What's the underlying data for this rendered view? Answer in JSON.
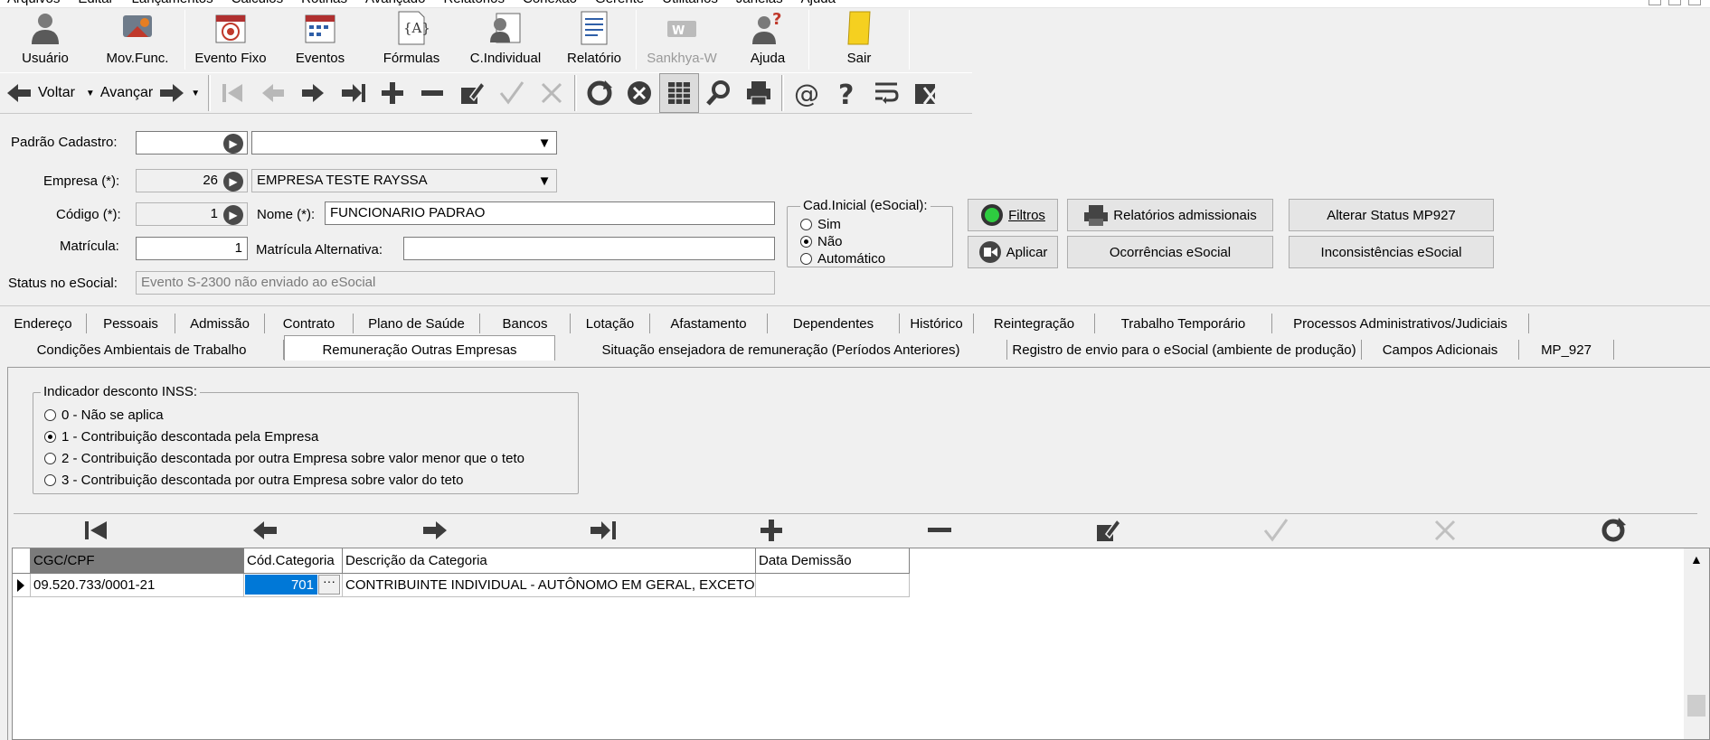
{
  "menu": [
    "Arquivos",
    "Editar",
    "Lançamentos",
    "Cálculos",
    "Rotinas",
    "Avançado",
    "Relatórios",
    "Conexão",
    "Gerente",
    "Utilitários",
    "Janelas",
    "Ajuda"
  ],
  "toolbar_main": {
    "usuario": "Usuário",
    "mov_func": "Mov.Func.",
    "evento_fixo": "Evento Fixo",
    "eventos": "Eventos",
    "formulas": "Fórmulas",
    "c_individual": "C.Individual",
    "relatorio": "Relatório",
    "sankhya": "Sankhya-W",
    "ajuda": "Ajuda",
    "sair": "Sair"
  },
  "toolbar_nav": {
    "voltar": "Voltar",
    "avancar": "Avançar"
  },
  "form": {
    "padrao_cadastro_label": "Padrão Cadastro:",
    "padrao_cadastro_code": "",
    "padrao_cadastro_name": "",
    "empresa_label": "Empresa (*):",
    "empresa_code": "26",
    "empresa_name": "EMPRESA TESTE RAYSSA",
    "codigo_label": "Código (*):",
    "codigo_value": "1",
    "nome_label": "Nome (*):",
    "nome_value": "FUNCIONARIO PADRAO",
    "matricula_label": "Matrícula:",
    "matricula_value": "1",
    "matricula_alt_label": "Matrícula Alternativa:",
    "matricula_alt_value": "",
    "status_label": "Status no eSocial:",
    "status_value": "Evento S-2300 não enviado ao eSocial"
  },
  "cad_inicial": {
    "title": "Cad.Inicial (eSocial):",
    "options": [
      "Sim",
      "Não",
      "Automático"
    ],
    "selected": "Não"
  },
  "buttons": {
    "filtros": "Filtros",
    "aplicar": "Aplicar",
    "relatorios_admissionais": "Relatórios admissionais",
    "ocorrencias_esocial": "Ocorrências eSocial",
    "alterar_status": "Alterar Status MP927",
    "inconsistencias": "Inconsistências eSocial"
  },
  "tabs_row1": [
    "Endereço",
    "Pessoais",
    "Admissão",
    "Contrato",
    "Plano de Saúde",
    "Bancos",
    "Lotação",
    "Afastamento",
    "Dependentes",
    "Histórico",
    "Reintegração",
    "Trabalho Temporário",
    "Processos Administrativos/Judiciais"
  ],
  "tabs_row2": [
    "Condições Ambientais de Trabalho",
    "Remuneração Outras Empresas",
    "Situação ensejadora de remuneração (Períodos Anteriores)",
    "Registro de envio para o eSocial (ambiente de produção)",
    "Campos Adicionais",
    "MP_927"
  ],
  "active_tab": "Remuneração Outras Empresas",
  "inss": {
    "title": "Indicador desconto INSS:",
    "options": [
      "0 - Não se aplica",
      "1 - Contribuição descontada pela Empresa",
      "2 - Contribuição descontada por outra Empresa sobre valor menor que o teto",
      "3 - Contribuição descontada por outra Empresa sobre valor do teto"
    ],
    "selected_index": 1
  },
  "grid": {
    "columns": [
      "CGC/CPF",
      "Cód.Categoria",
      "Descrição da Categoria",
      "Data Demissão"
    ],
    "rows": [
      {
        "cgc_cpf": "09.520.733/0001-21",
        "cod_categoria": "701",
        "descricao": "CONTRIBUINTE INDIVIDUAL - AUTÔNOMO EM GERAL, EXCETO",
        "data_demissao": ""
      }
    ]
  },
  "colors": {
    "accent": "#0078d7",
    "toolbar_icon": "#3c3c3c",
    "disabled": "#b8b8b8",
    "window_bg": "#f0f0f0"
  }
}
